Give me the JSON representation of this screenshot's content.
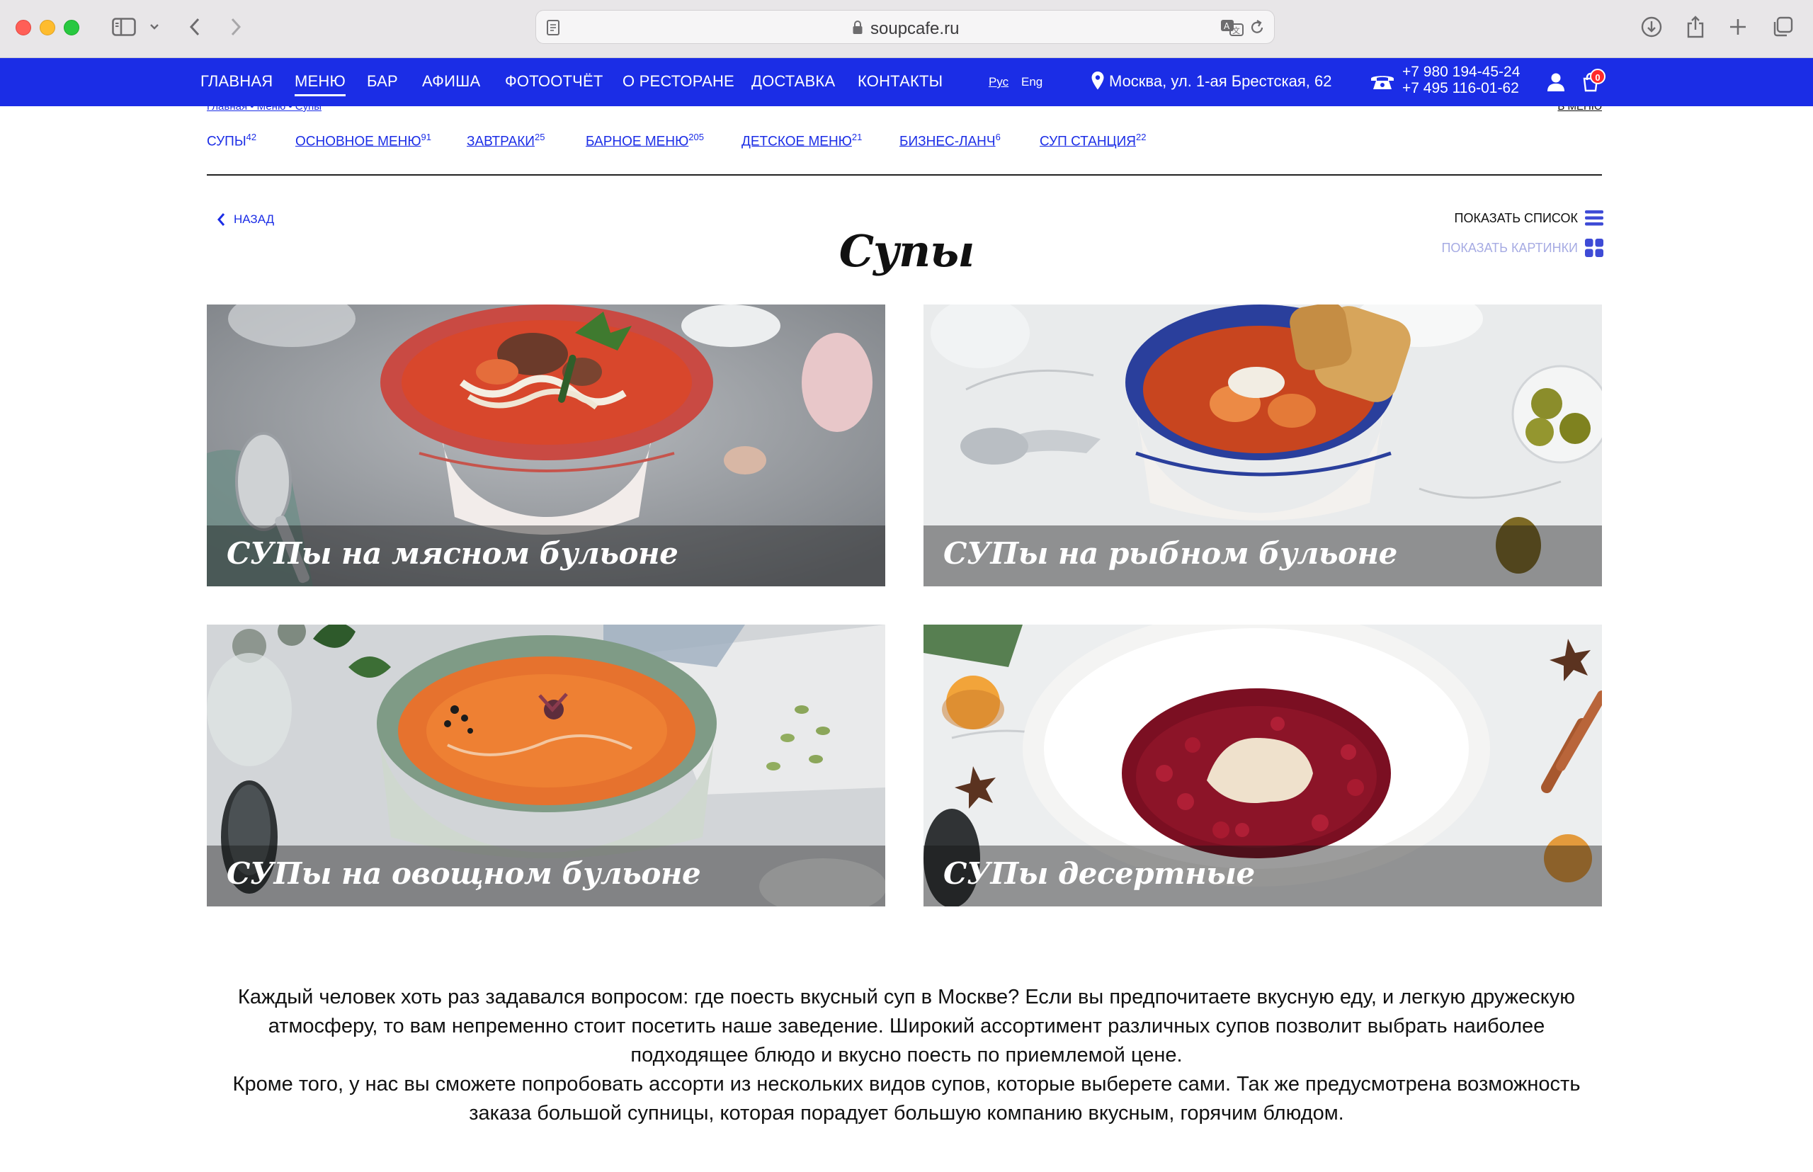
{
  "browser": {
    "url": "soupcafe.ru"
  },
  "nav": {
    "items": [
      {
        "label": "ГЛАВНАЯ"
      },
      {
        "label": "МЕНЮ"
      },
      {
        "label": "БАР"
      },
      {
        "label": "АФИША"
      },
      {
        "label": "ФОТООТЧЁТ"
      },
      {
        "label": "О РЕСТОРАНЕ"
      },
      {
        "label": "ДОСТАВКА"
      },
      {
        "label": "КОНТАКТЫ"
      }
    ],
    "active": "МЕНЮ",
    "lang_ru": "Рус",
    "lang_en": "Eng",
    "address": "Москва, ул. 1-ая Брестская, 62",
    "phone1": "+7 980 194-45-24",
    "phone2": "+7 495 116-01-62",
    "cart_count": "0",
    "accent_color": "#1b2de6"
  },
  "breadcrumb": "Главная • Меню • Супы",
  "back_to_menu": "В МЕНЮ",
  "subnav": [
    {
      "label": "СУПЫ",
      "count": "42"
    },
    {
      "label": "ОСНОВНОЕ МЕНЮ",
      "count": "91"
    },
    {
      "label": "ЗАВТРАКИ",
      "count": "25"
    },
    {
      "label": "БАРНОЕ МЕНЮ",
      "count": "205"
    },
    {
      "label": "ДЕТСКОЕ МЕНЮ",
      "count": "21"
    },
    {
      "label": "БИЗНЕС-ЛАНЧ",
      "count": "6"
    },
    {
      "label": "СУП СТАНЦИЯ",
      "count": "22"
    }
  ],
  "page": {
    "back_label": "НАЗАД",
    "title": "Супы",
    "show_list": "ПОКАЗАТЬ СПИСОК",
    "show_pictures": "ПОКАЗАТЬ КАРТИНКИ"
  },
  "cards": [
    {
      "caption": "СУПы на мясном бульоне"
    },
    {
      "caption": "СУПы на рыбном бульоне"
    },
    {
      "caption": "СУПы на овощном бульоне"
    },
    {
      "caption": "СУПы десертные"
    }
  ],
  "description": {
    "p1": "Каждый человек  хоть раз задавался вопросом: где поесть вкусный суп в Москве? Если вы предпочитаете вкусную еду, и легкую дружескую атмосферу, то вам непременно стоит посетить наше заведение. Широкий ассортимент различных супов позволит выбрать наиболее подходящее блюдо и вкусно поесть по приемлемой цене.",
    "p2": "Кроме того, у нас вы сможете попробовать ассорти из нескольких видов супов, которые выберете сами. Так же предусмотрена возможность заказа большой супницы, которая порадует большую компанию вкусным, горячим блюдом."
  }
}
